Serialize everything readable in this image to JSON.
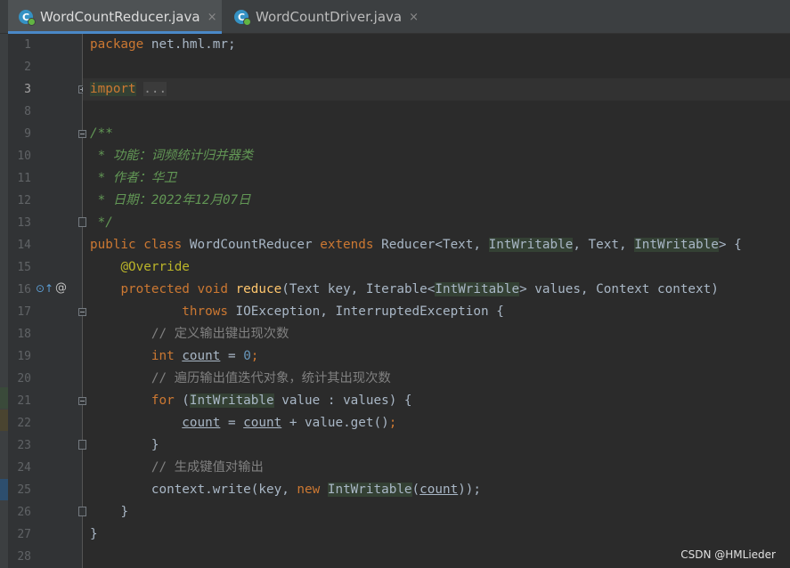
{
  "tabs": [
    {
      "icon_letter": "C",
      "label": "WordCountReducer.java",
      "close": "×",
      "active": true
    },
    {
      "icon_letter": "C",
      "label": "WordCountDriver.java",
      "close": "×",
      "active": false
    }
  ],
  "gutter": {
    "line_numbers": [
      "1",
      "2",
      "3",
      "8",
      "9",
      "10",
      "11",
      "12",
      "13",
      "14",
      "15",
      "16",
      "17",
      "18",
      "19",
      "20",
      "21",
      "22",
      "23",
      "24",
      "25",
      "26",
      "27",
      "28"
    ],
    "current_line": "3",
    "line16_markers": {
      "override_icon": "⊙↑",
      "at_sign": "@"
    }
  },
  "code": {
    "line_1": {
      "kw": "package",
      "rest": " net.hml.mr;"
    },
    "line_3": {
      "kw": "import",
      "folded": "..."
    },
    "line_9": {
      "text": "/**"
    },
    "line_10": {
      "text": " * 功能：词频统计归并器类"
    },
    "line_11": {
      "text": " * 作者：华卫"
    },
    "line_12": {
      "text": " * 日期：2022年12月07日"
    },
    "line_13": {
      "text": " */"
    },
    "line_14": {
      "kw1": "public class",
      "name": " WordCountReducer ",
      "kw2": "extends",
      "p1": " Reducer<Text, ",
      "t1": "IntWritable",
      "p2": ", Text, ",
      "t2": "IntWritable",
      "p3": "> {"
    },
    "line_15": {
      "annotation": "@Override"
    },
    "line_16": {
      "kw": "protected void",
      "fn": "reduce",
      "p1": "(Text key, Iterable<",
      "t1": "IntWritable",
      "p2": "> values, Context context)"
    },
    "line_17": {
      "kw": "throws",
      "rest": " IOException, InterruptedException {"
    },
    "line_18": {
      "comment": "// 定义输出键出现次数"
    },
    "line_19": {
      "kw": "int",
      "var": "count",
      "p1": " = ",
      "num": "0",
      "p2": ";"
    },
    "line_20": {
      "comment": "// 遍历输出值迭代对象，统计其出现次数"
    },
    "line_21": {
      "kw": "for",
      "p1": " (",
      "t1": "IntWritable",
      "p2": " value : values) {"
    },
    "line_22": {
      "var1": "count",
      "p1": " = ",
      "var2": "count",
      "p2": " + value.get()",
      "p3": ";"
    },
    "line_23": {
      "text": "}"
    },
    "line_24": {
      "comment": "// 生成键值对输出"
    },
    "line_25": {
      "p1": "context.write(key, ",
      "kw": "new",
      "p2": " ",
      "t1": "IntWritable",
      "p3": "(",
      "var": "count",
      "p4": "));"
    },
    "line_26": {
      "text": "}"
    },
    "line_27": {
      "text": "}"
    }
  },
  "watermark": "CSDN @HMLieder",
  "colors": {
    "background": "#2b2b2b",
    "keyword": "#cc7832",
    "annotation": "#bbb529",
    "method": "#ffc66d",
    "number": "#6897bb",
    "comment": "#808080",
    "doc_comment": "#629755",
    "accent": "#4a88c7"
  }
}
